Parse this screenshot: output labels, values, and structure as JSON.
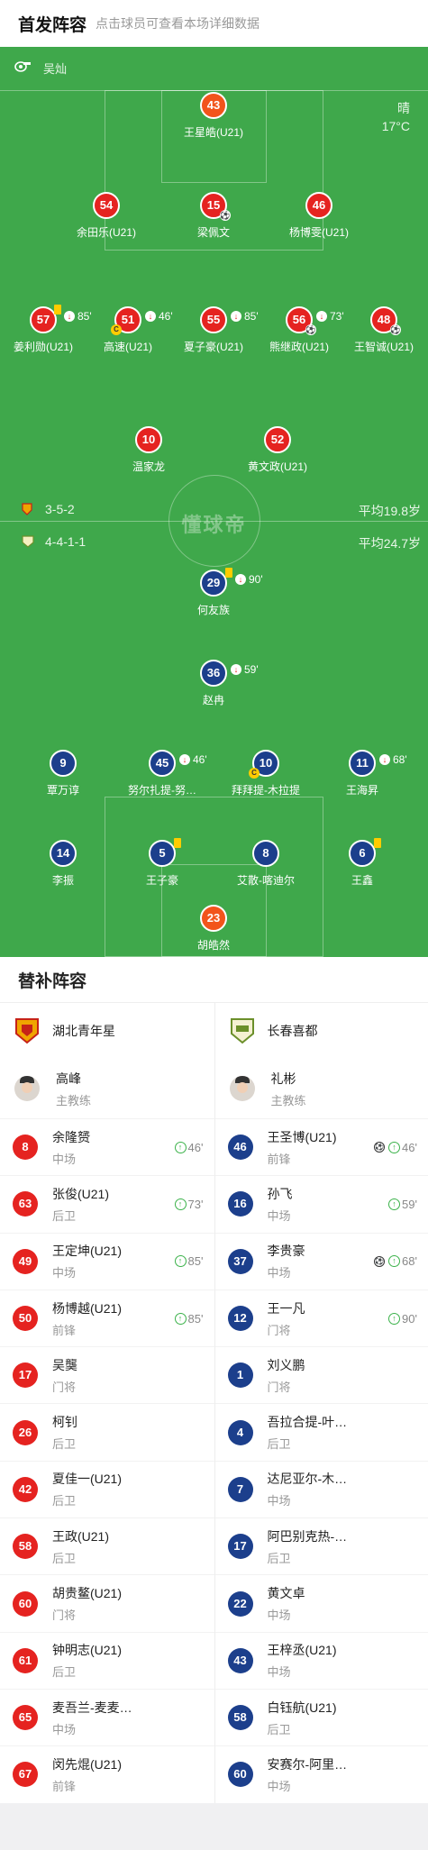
{
  "header": {
    "title": "首发阵容",
    "subtitle": "点击球员可查看本场详细数据"
  },
  "pitch": {
    "referee": "吴灿",
    "weather": "晴",
    "temperature": "17°C",
    "watermark": "懂球帝",
    "home_form": "3-5-2",
    "home_avg_age": "平均19.8岁",
    "away_form": "4-4-1-1",
    "away_avg_age": "平均24.7岁"
  },
  "home_players": [
    {
      "num": "43",
      "name": "王星皓(U21)"
    },
    {
      "num": "54",
      "name": "余田乐(U21)"
    },
    {
      "num": "15",
      "name": "梁佩文"
    },
    {
      "num": "46",
      "name": "杨博雯(U21)"
    },
    {
      "num": "57",
      "name": "姜利勋(U21)",
      "sub": "85'"
    },
    {
      "num": "51",
      "name": "高速(U21)",
      "sub": "46'"
    },
    {
      "num": "55",
      "name": "夏子豪(U21)",
      "sub": "85'"
    },
    {
      "num": "56",
      "name": "熊继政(U21)",
      "sub": "73'"
    },
    {
      "num": "48",
      "name": "王智诚(U21)"
    },
    {
      "num": "10",
      "name": "温家龙"
    },
    {
      "num": "52",
      "name": "黄文政(U21)"
    }
  ],
  "away_players": [
    {
      "num": "29",
      "name": "何友族",
      "sub": "90'"
    },
    {
      "num": "36",
      "name": "赵冉",
      "sub": "59'"
    },
    {
      "num": "9",
      "name": "覃万谆"
    },
    {
      "num": "45",
      "name": "努尔扎提-努…",
      "sub": "46'"
    },
    {
      "num": "10",
      "name": "拜拜提-木拉提"
    },
    {
      "num": "11",
      "name": "王海昇",
      "sub": "68'"
    },
    {
      "num": "14",
      "name": "李振"
    },
    {
      "num": "5",
      "name": "王子豪"
    },
    {
      "num": "8",
      "name": "艾散-喀迪尔"
    },
    {
      "num": "6",
      "name": "王鑫"
    },
    {
      "num": "23",
      "name": "胡皓然"
    }
  ],
  "bench": {
    "title": "替补阵容",
    "home_team": "湖北青年星",
    "away_team": "长春喜都",
    "home_coach": {
      "name": "高峰",
      "role": "主教练"
    },
    "away_coach": {
      "name": "礼彬",
      "role": "主教练"
    },
    "home": [
      {
        "num": "8",
        "name": "余隆赟",
        "pos": "中场",
        "sub": "46'"
      },
      {
        "num": "63",
        "name": "张俊(U21)",
        "pos": "后卫",
        "sub": "73'"
      },
      {
        "num": "49",
        "name": "王定坤(U21)",
        "pos": "中场",
        "sub": "85'"
      },
      {
        "num": "50",
        "name": "杨博越(U21)",
        "pos": "前锋",
        "sub": "85'"
      },
      {
        "num": "17",
        "name": "吴龑",
        "pos": "门将"
      },
      {
        "num": "26",
        "name": "柯钊",
        "pos": "后卫"
      },
      {
        "num": "42",
        "name": "夏佳一(U21)",
        "pos": "后卫"
      },
      {
        "num": "58",
        "name": "王政(U21)",
        "pos": "后卫"
      },
      {
        "num": "60",
        "name": "胡贵鳌(U21)",
        "pos": "门将"
      },
      {
        "num": "61",
        "name": "钟明志(U21)",
        "pos": "后卫"
      },
      {
        "num": "65",
        "name": "麦吾兰-麦麦…",
        "pos": "中场"
      },
      {
        "num": "67",
        "name": "闵先焜(U21)",
        "pos": "前锋"
      }
    ],
    "away": [
      {
        "num": "46",
        "name": "王圣博(U21)",
        "pos": "前锋",
        "sub": "46'",
        "goal": true
      },
      {
        "num": "16",
        "name": "孙飞",
        "pos": "中场",
        "sub": "59'"
      },
      {
        "num": "37",
        "name": "李贵豪",
        "pos": "中场",
        "sub": "68'",
        "goal": true
      },
      {
        "num": "12",
        "name": "王一凡",
        "pos": "门将",
        "sub": "90'"
      },
      {
        "num": "1",
        "name": "刘义鹏",
        "pos": "门将"
      },
      {
        "num": "4",
        "name": "吾拉合提-叶…",
        "pos": "后卫"
      },
      {
        "num": "7",
        "name": "达尼亚尔-木…",
        "pos": "中场"
      },
      {
        "num": "17",
        "name": "阿巴别克热-…",
        "pos": "后卫"
      },
      {
        "num": "22",
        "name": "黄文卓",
        "pos": "中场"
      },
      {
        "num": "43",
        "name": "王梓丞(U21)",
        "pos": "中场"
      },
      {
        "num": "58",
        "name": "白钰航(U21)",
        "pos": "后卫"
      },
      {
        "num": "60",
        "name": "安赛尔-阿里…",
        "pos": "中场"
      }
    ]
  }
}
